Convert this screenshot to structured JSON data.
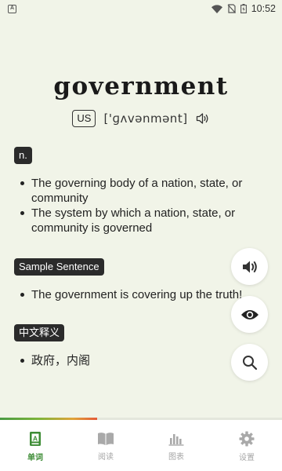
{
  "status_bar": {
    "notification_icon": "app-notification-icon",
    "time": "10:52"
  },
  "word": {
    "headword": "government",
    "accent": "US",
    "phonetic": "['ɡʌvənmənt]",
    "pronounce_icon": "speaker-icon"
  },
  "definition": {
    "part_of_speech": "n.",
    "items": [
      "The governing body of a nation, state, or community",
      "The system by which a nation, state, or community is governed"
    ]
  },
  "sample": {
    "label": "Sample Sentence",
    "items": [
      "The government is covering up the truth!"
    ]
  },
  "chinese": {
    "label": "中文释义",
    "items": [
      "政府，内阁"
    ]
  },
  "actions": {
    "speak_icon": "volume-icon",
    "reveal_icon": "eye-icon",
    "search_icon": "search-icon"
  },
  "progress": {
    "fraction": 0.345
  },
  "bottom_nav": [
    {
      "label": "单词",
      "icon": "word-card-icon",
      "active": true
    },
    {
      "label": "阅读",
      "icon": "book-icon",
      "active": false
    },
    {
      "label": "图表",
      "icon": "bar-chart-icon",
      "active": false
    },
    {
      "label": "设置",
      "icon": "gear-icon",
      "active": false
    }
  ],
  "colors": {
    "background": "#f1f4e8",
    "accent": "#3d8c35",
    "tag": "#2b2b2b"
  }
}
